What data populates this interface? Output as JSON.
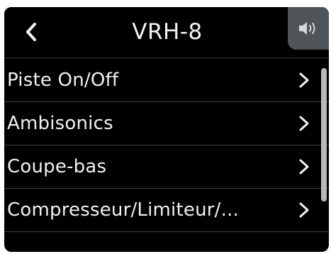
{
  "header": {
    "title": "VRH-8",
    "back_icon": "chevron-left-icon",
    "speaker_icon": "speaker-icon"
  },
  "menu": {
    "items": [
      {
        "label": "Piste On/Off",
        "icon": "chevron-right-icon"
      },
      {
        "label": "Ambisonics",
        "icon": "chevron-right-icon"
      },
      {
        "label": "Coupe-bas",
        "icon": "chevron-right-icon"
      },
      {
        "label": "Compresseur/Limiteur/...",
        "icon": "chevron-right-icon"
      }
    ]
  },
  "scroll": {
    "visible_fraction": 0.8
  },
  "colors": {
    "background": "#000000",
    "text": "#f1f1f1",
    "divider": "#3f3f3f",
    "speaker_button": "#4f5458",
    "scrollbar": "#b9b9b9"
  }
}
